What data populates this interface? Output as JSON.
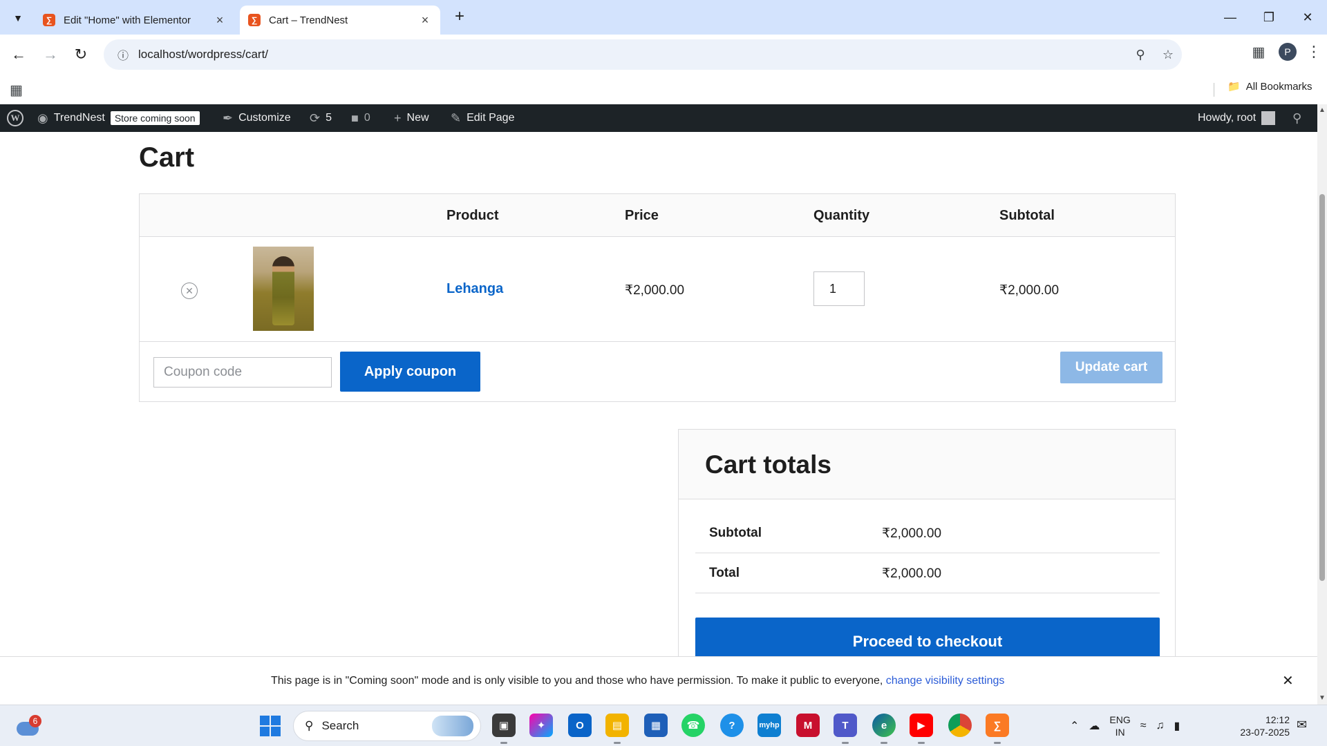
{
  "browser": {
    "tabs": [
      {
        "title": "Edit \"Home\" with Elementor",
        "active": false
      },
      {
        "title": "Cart – TrendNest",
        "active": true
      }
    ],
    "url": "localhost/wordpress/cart/",
    "profile_initial": "P",
    "all_bookmarks_label": "All Bookmarks"
  },
  "adminbar": {
    "site_name": "TrendNest",
    "store_badge": "Store coming soon",
    "customize_label": "Customize",
    "updates_count": "5",
    "comments_count": "0",
    "new_label": "New",
    "edit_page_label": "Edit Page",
    "howdy_label": "Howdy, root"
  },
  "page": {
    "title": "Cart"
  },
  "cart": {
    "headers": {
      "product": "Product",
      "price": "Price",
      "quantity": "Quantity",
      "subtotal": "Subtotal"
    },
    "items": [
      {
        "name": "Lehanga",
        "price": "₹2,000.00",
        "quantity": "1",
        "subtotal": "₹2,000.00"
      }
    ],
    "coupon_placeholder": "Coupon code",
    "apply_coupon_label": "Apply coupon",
    "update_cart_label": "Update cart"
  },
  "totals": {
    "title": "Cart totals",
    "subtotal_label": "Subtotal",
    "subtotal_value": "₹2,000.00",
    "total_label": "Total",
    "total_value": "₹2,000.00",
    "checkout_label": "Proceed to checkout"
  },
  "notice": {
    "text": "This page is in \"Coming soon\" mode and is only visible to you and those who have permission. To make it public to everyone, ",
    "link_text": "change visibility settings"
  },
  "taskbar": {
    "weather_badge": "6",
    "search_label": "Search",
    "language_line1": "ENG",
    "language_line2": "IN",
    "time": "12:12",
    "date": "23-07-2025"
  },
  "colors": {
    "accent": "#0a65c9",
    "adminbar": "#1d2327",
    "update_cart_disabled": "#8db8e6"
  }
}
